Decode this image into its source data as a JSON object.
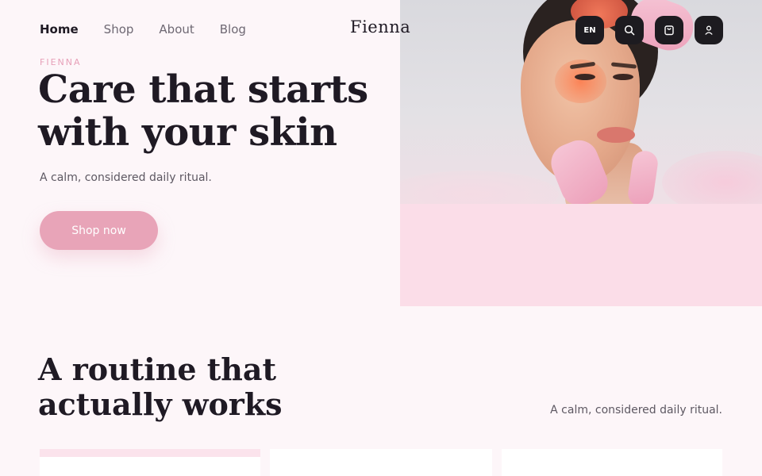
{
  "nav": {
    "items": [
      {
        "label": "Home",
        "active": true
      },
      {
        "label": "Shop",
        "active": false
      },
      {
        "label": "About",
        "active": false
      },
      {
        "label": "Blog",
        "active": false
      }
    ]
  },
  "brand": {
    "logo": "Fienna"
  },
  "header_actions": {
    "language": "EN",
    "icons": [
      "search-icon",
      "bag-icon",
      "user-icon"
    ]
  },
  "hero": {
    "eyebrow": "FIENNA",
    "headline": "Care that starts with your skin",
    "subtitle": "A calm, considered daily ritual.",
    "cta_label": "Shop now"
  },
  "routine": {
    "title": "A routine that actually works",
    "subtitle": "A calm, considered daily ritual."
  },
  "colors": {
    "accent": "#e8a4b8",
    "hero_panel": "#fbdde8",
    "background": "#fdf6f9",
    "dark_button": "#1d1b20"
  }
}
